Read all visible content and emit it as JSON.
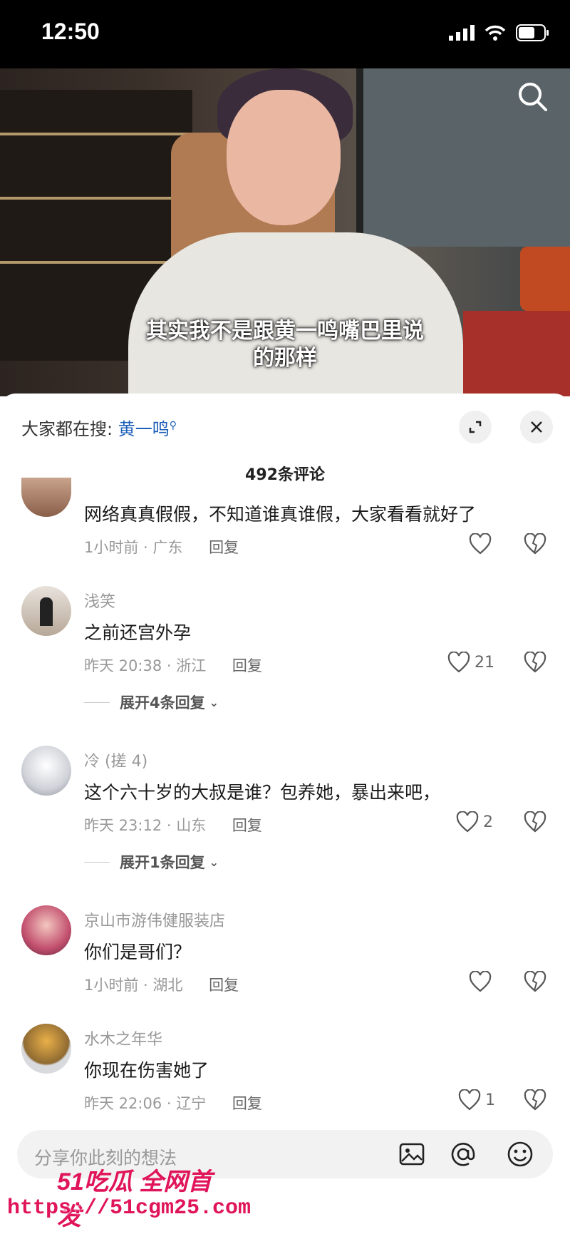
{
  "status": {
    "time": "12:50"
  },
  "video": {
    "subtitle_line1": "其实我不是跟黄一鸣嘴巴里说",
    "subtitle_line2": "的那样"
  },
  "sheet": {
    "search_prefix": "大家都在搜:",
    "search_term": "黄一鸣",
    "comment_count": "492条评论"
  },
  "comments": [
    {
      "name": "",
      "text": "网络真真假假，不知道谁真谁假，大家看看就好了",
      "time": "1小时前 · 广东",
      "reply": "回复",
      "likes": ""
    },
    {
      "name": "浅笑",
      "text": "之前还宫外孕",
      "time": "昨天 20:38 · 浙江",
      "reply": "回复",
      "likes": "21",
      "expand": "展开4条回复"
    },
    {
      "name": "冷 (搓 4)",
      "text": "这个六十岁的大叔是谁？包养她，暴出来吧，",
      "time": "昨天 23:12 · 山东",
      "reply": "回复",
      "likes": "2",
      "expand": "展开1条回复"
    },
    {
      "name": "京山市游伟健服装店",
      "text": "你们是哥们？",
      "time": "1小时前 · 湖北",
      "reply": "回复",
      "likes": ""
    },
    {
      "name": "水木之年华",
      "text": "你现在伤害她了",
      "time": "昨天 22:06 · 辽宁",
      "reply": "回复",
      "likes": "1"
    }
  ],
  "input": {
    "placeholder": "分享你此刻的想法"
  },
  "watermark": {
    "logo": "51吃瓜 全网首发",
    "url": "https://51cgm25.com"
  },
  "icons": [
    "signal-icon",
    "wifi-icon",
    "battery-icon",
    "search-icon",
    "collapse-icon",
    "close-icon",
    "heart-icon",
    "broken-heart-icon",
    "image-icon",
    "at-icon",
    "emoji-icon"
  ]
}
